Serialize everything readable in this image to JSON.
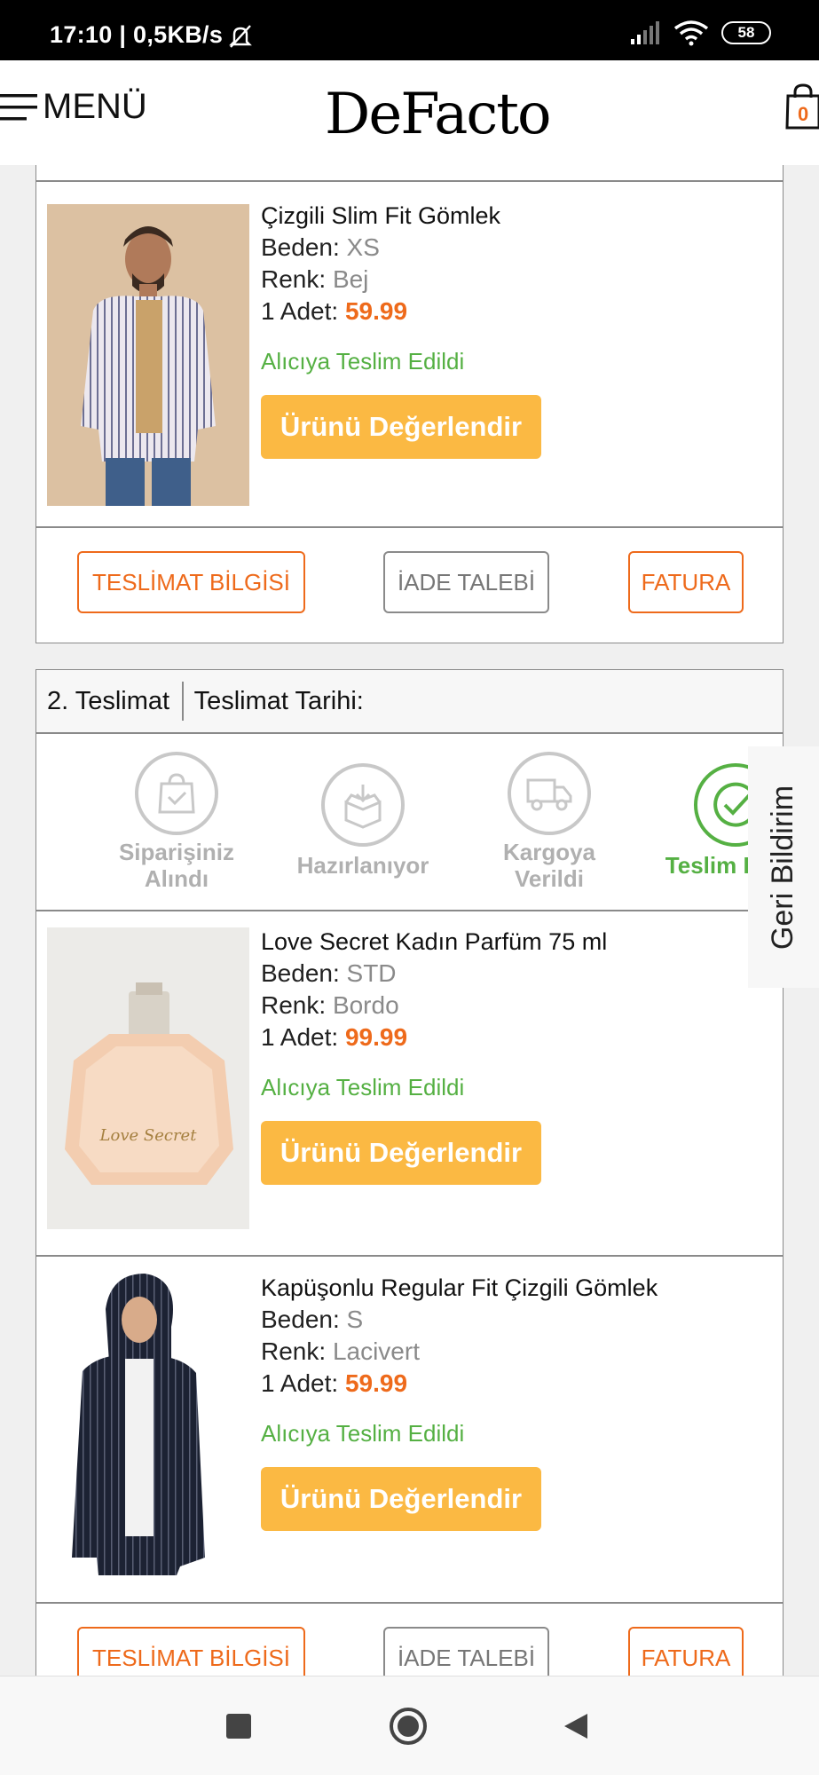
{
  "status_bar": {
    "time_speed": "17:10 | 0,5KB/s",
    "battery": "58"
  },
  "header": {
    "menu_label": "MENÜ",
    "logo": "DeFacto",
    "cart_count": "0"
  },
  "delivery1": {
    "product": {
      "title": "Çizgili Slim Fit Gömlek",
      "size_label": "Beden:",
      "size": "XS",
      "color_label": "Renk:",
      "color": "Bej",
      "qty_label": "1 Adet:",
      "price": "59.99",
      "status": "Alıcıya Teslim Edildi",
      "rate_button": "Ürünü Değerlendir"
    },
    "actions": {
      "delivery_info": "TESLİMAT BİLGİSİ",
      "return_request": "İADE TALEBİ",
      "invoice": "FATURA"
    }
  },
  "delivery2": {
    "header": {
      "number": "2. Teslimat",
      "date_label": "Teslimat Tarihi:"
    },
    "steps": [
      {
        "line1": "Siparişiniz",
        "line2": "Alındı",
        "icon": "bag-check-icon"
      },
      {
        "line1": "Hazırlanıyor",
        "line2": "",
        "icon": "box-icon"
      },
      {
        "line1": "Kargoya",
        "line2": "Verildi",
        "icon": "truck-icon"
      },
      {
        "line1": "Teslim Edildi",
        "line2": "",
        "icon": "check-circle-icon"
      }
    ],
    "products": [
      {
        "title": "Love Secret Kadın Parfüm 75 ml",
        "size_label": "Beden:",
        "size": "STD",
        "color_label": "Renk:",
        "color": "Bordo",
        "qty_label": "1 Adet:",
        "price": "99.99",
        "status": "Alıcıya Teslim Edildi",
        "rate_button": "Ürünü Değerlendir"
      },
      {
        "title": "Kapüşonlu Regular Fit Çizgili Gömlek",
        "size_label": "Beden:",
        "size": "S",
        "color_label": "Renk:",
        "color": "Lacivert",
        "qty_label": "1 Adet:",
        "price": "59.99",
        "status": "Alıcıya Teslim Edildi",
        "rate_button": "Ürünü Değerlendir"
      }
    ],
    "actions": {
      "delivery_info": "TESLİMAT BİLGİSİ",
      "return_request": "İADE TALEBİ",
      "invoice": "FATURA"
    }
  },
  "feedback_tab": "Geri Bildirim",
  "colors": {
    "accent_orange": "#ee6a1b",
    "button_yellow": "#fbb943",
    "success_green": "#55b043"
  }
}
